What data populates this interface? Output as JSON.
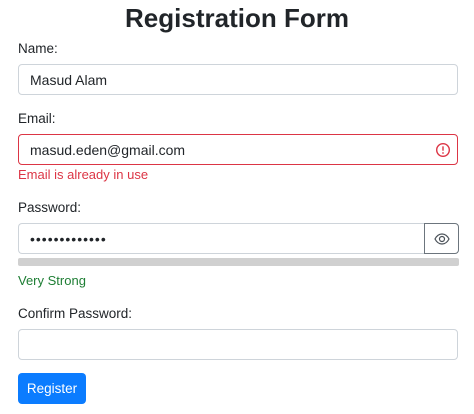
{
  "form": {
    "title": "Registration Form",
    "name": {
      "label": "Name:",
      "value": "Masud Alam"
    },
    "email": {
      "label": "Email:",
      "value": "masud.eden@gmail.com",
      "error": "Email is already in use",
      "error_icon": "exclamation-circle-icon"
    },
    "password": {
      "label": "Password:",
      "value": "•••••••••••••",
      "toggle_icon": "eye-icon",
      "strength_label": "Very Strong",
      "strength_fraction": 1.0
    },
    "confirm_password": {
      "label": "Confirm Password:",
      "value": ""
    },
    "submit_label": "Register"
  },
  "colors": {
    "primary": "#0b7cff",
    "danger": "#dc3545",
    "success": "#1e7e34",
    "input_border": "#ced4da"
  }
}
